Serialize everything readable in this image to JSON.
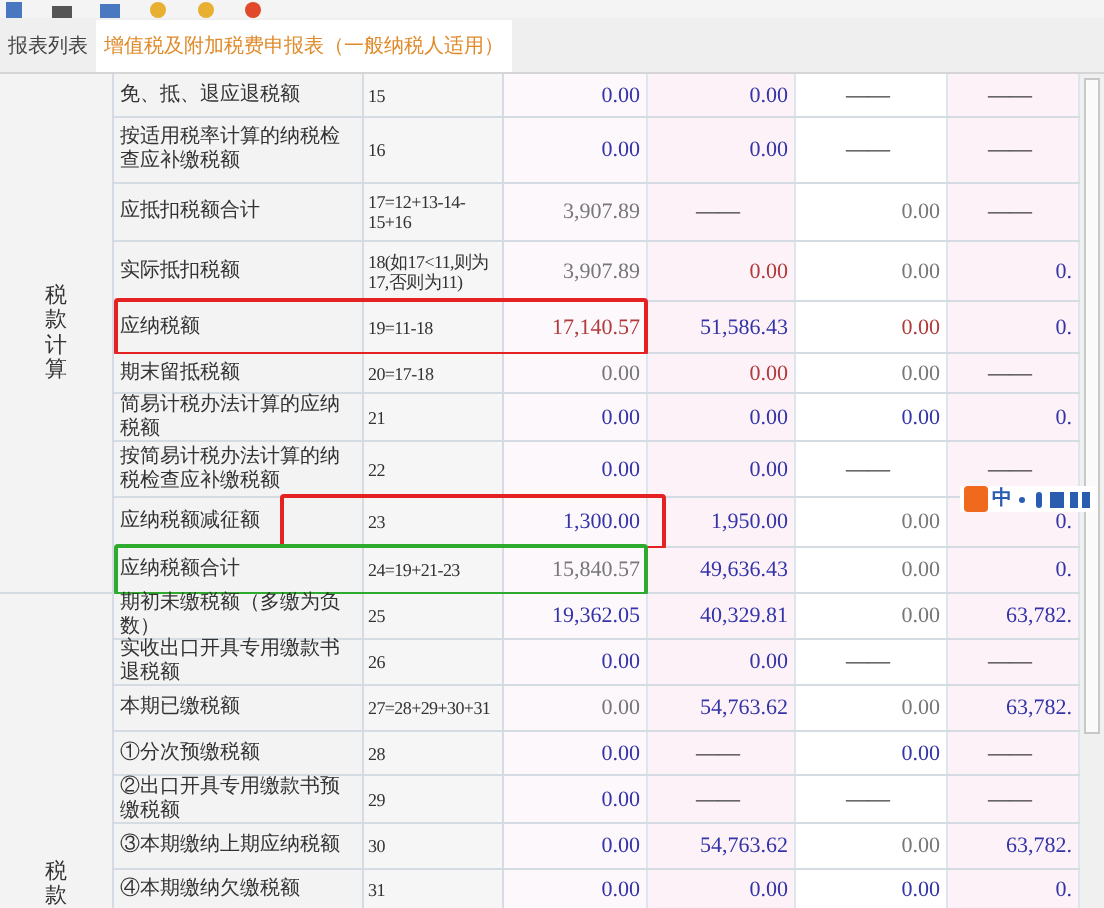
{
  "tabs": [
    {
      "label": "报表列表",
      "selected": false
    },
    {
      "label": "增值税及附加税费申报表（一般纳税人适用）",
      "selected": true
    }
  ],
  "sections": [
    {
      "label": "税款计算",
      "rows": [
        {
          "name": "免、抵、退应退税额",
          "formula": "15",
          "cells": [
            {
              "text": "0.00",
              "color": "#3434a8"
            },
            {
              "text": "0.00",
              "color": "#3434a8"
            },
            {
              "text": "——"
            },
            {
              "text": "——"
            }
          ]
        },
        {
          "name": "按适用税率计算的纳税检查应补缴税额",
          "formula": "16",
          "cells": [
            {
              "text": "0.00",
              "color": "#3434a8"
            },
            {
              "text": "0.00",
              "color": "#3434a8"
            },
            {
              "text": "——"
            },
            {
              "text": "——"
            }
          ]
        },
        {
          "name": "应抵扣税额合计",
          "formula": "17=12+13-14-15+16",
          "cells": [
            {
              "text": "3,907.89",
              "color": "#777777"
            },
            {
              "text": "——"
            },
            {
              "text": "0.00",
              "color": "#777777"
            },
            {
              "text": "——"
            }
          ]
        },
        {
          "name": "实际抵扣税额",
          "formula": "18(如17<11,则为17,否则为11)",
          "cells": [
            {
              "text": "3,907.89",
              "color": "#777777"
            },
            {
              "text": "0.00",
              "color": "#b23a3a"
            },
            {
              "text": "0.00",
              "color": "#777777"
            },
            {
              "text": "0.",
              "color": "#3434a8"
            }
          ]
        },
        {
          "name": "应纳税额",
          "formula": "19=11-18",
          "highlight": {
            "kind": "wide",
            "color": "#e52222"
          },
          "cells": [
            {
              "text": "17,140.57",
              "color": "#b23a3a"
            },
            {
              "text": "51,586.43",
              "color": "#3434a8"
            },
            {
              "text": "0.00",
              "color": "#b23a3a"
            },
            {
              "text": "0.",
              "color": "#3434a8"
            }
          ]
        },
        {
          "name": "期末留抵税额",
          "formula": "20=17-18",
          "cells": [
            {
              "text": "0.00",
              "color": "#777777"
            },
            {
              "text": "0.00",
              "color": "#b23a3a"
            },
            {
              "text": "0.00",
              "color": "#777777"
            },
            {
              "text": "——"
            }
          ]
        },
        {
          "name": "简易计税办法计算的应纳税额",
          "formula": "21",
          "cells": [
            {
              "text": "0.00",
              "color": "#3434a8"
            },
            {
              "text": "0.00",
              "color": "#3434a8"
            },
            {
              "text": "0.00",
              "color": "#3434a8"
            },
            {
              "text": "0.",
              "color": "#3434a8"
            }
          ]
        },
        {
          "name": "按简易计税办法计算的纳税检查应补缴税额",
          "formula": "22",
          "cells": [
            {
              "text": "0.00",
              "color": "#3434a8"
            },
            {
              "text": "0.00",
              "color": "#3434a8"
            },
            {
              "text": "——"
            },
            {
              "text": "——"
            }
          ]
        },
        {
          "name": "应纳税额减征额",
          "formula": "23",
          "highlight": {
            "kind": "offset",
            "color": "#e52222"
          },
          "cells": [
            {
              "text": "1,300.00",
              "color": "#3434a8"
            },
            {
              "text": "1,950.00",
              "color": "#3434a8"
            },
            {
              "text": "0.00",
              "color": "#777777"
            },
            {
              "text": "0.",
              "color": "#3434a8"
            }
          ]
        },
        {
          "name": "应纳税额合计",
          "formula": "24=19+21-23",
          "highlight": {
            "kind": "wide",
            "color": "#2eaa2e"
          },
          "cells": [
            {
              "text": "15,840.57",
              "color": "#777777"
            },
            {
              "text": "49,636.43",
              "color": "#3434a8"
            },
            {
              "text": "0.00",
              "color": "#777777"
            },
            {
              "text": "0.",
              "color": "#3434a8"
            }
          ]
        }
      ]
    },
    {
      "label": "税款",
      "rows": [
        {
          "name": "期初未缴税额（多缴为负数）",
          "formula": "25",
          "cells": [
            {
              "text": "19,362.05",
              "color": "#3434a8"
            },
            {
              "text": "40,329.81",
              "color": "#3434a8"
            },
            {
              "text": "0.00",
              "color": "#777777"
            },
            {
              "text": "63,782.",
              "color": "#3434a8"
            }
          ]
        },
        {
          "name": "实收出口开具专用缴款书退税额",
          "formula": "26",
          "cells": [
            {
              "text": "0.00",
              "color": "#3434a8"
            },
            {
              "text": "0.00",
              "color": "#3434a8"
            },
            {
              "text": "——"
            },
            {
              "text": "——"
            }
          ]
        },
        {
          "name": "本期已缴税额",
          "formula": "27=28+29+30+31",
          "cells": [
            {
              "text": "0.00",
              "color": "#777777"
            },
            {
              "text": "54,763.62",
              "color": "#3434a8"
            },
            {
              "text": "0.00",
              "color": "#777777"
            },
            {
              "text": "63,782.",
              "color": "#3434a8"
            }
          ]
        },
        {
          "name": "①分次预缴税额",
          "formula": "28",
          "cells": [
            {
              "text": "0.00",
              "color": "#3434a8"
            },
            {
              "text": "——"
            },
            {
              "text": "0.00",
              "color": "#3434a8"
            },
            {
              "text": "——"
            }
          ]
        },
        {
          "name": "②出口开具专用缴款书预缴税额",
          "formula": "29",
          "cells": [
            {
              "text": "0.00",
              "color": "#3434a8"
            },
            {
              "text": "——"
            },
            {
              "text": "——"
            },
            {
              "text": "——"
            }
          ]
        },
        {
          "name": "③本期缴纳上期应纳税额",
          "formula": "30",
          "cells": [
            {
              "text": "0.00",
              "color": "#3434a8"
            },
            {
              "text": "54,763.62",
              "color": "#3434a8"
            },
            {
              "text": "0.00",
              "color": "#777777"
            },
            {
              "text": "63,782.",
              "color": "#3434a8"
            }
          ]
        },
        {
          "name": "④本期缴纳欠缴税额",
          "formula": "31",
          "cells": [
            {
              "text": "0.00",
              "color": "#3434a8"
            },
            {
              "text": "0.00",
              "color": "#3434a8"
            },
            {
              "text": "0.00",
              "color": "#3434a8"
            },
            {
              "text": "0.",
              "color": "#3434a8"
            }
          ]
        }
      ]
    }
  ],
  "ime_toolbar": {
    "label": "中"
  }
}
